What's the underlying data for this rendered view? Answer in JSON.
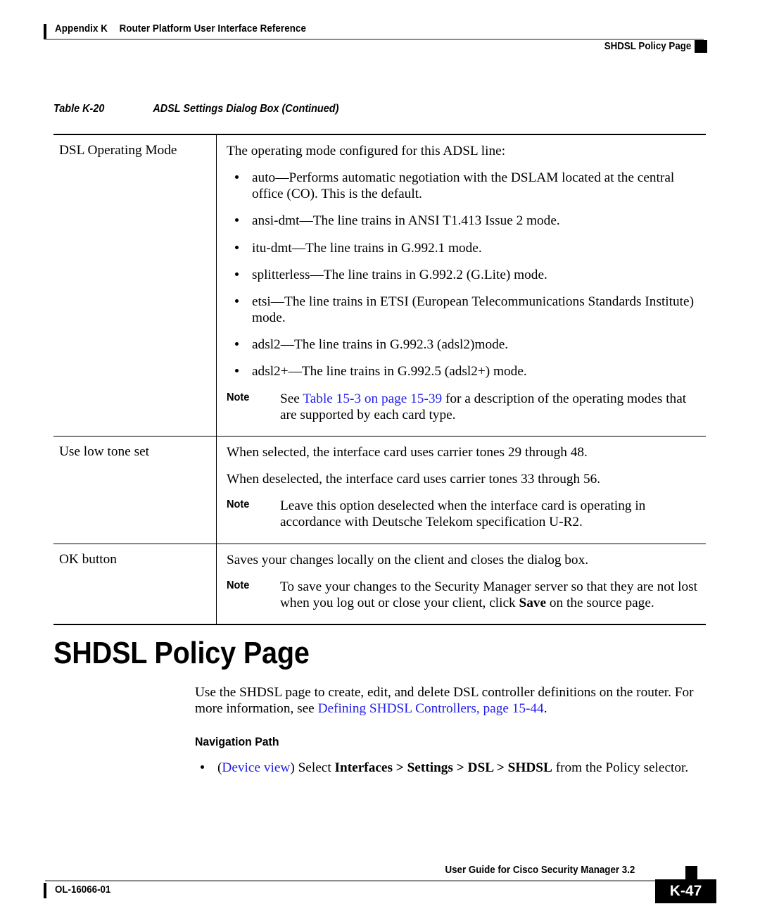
{
  "header": {
    "appendix": "Appendix K",
    "title": "Router Platform User Interface Reference",
    "section": "SHDSL Policy Page"
  },
  "table": {
    "caption_number": "Table K-20",
    "caption_title": "ADSL Settings Dialog Box (Continued)",
    "rows": [
      {
        "label": "DSL Operating Mode",
        "intro": "The operating mode configured for this ADSL line:",
        "bullets": [
          "auto—Performs automatic negotiation with the DSLAM located at the central office (CO). This is the default.",
          "ansi-dmt—The line trains in ANSI T1.413 Issue 2 mode.",
          "itu-dmt—The line trains in G.992.1 mode.",
          "splitterless—The line trains in G.992.2 (G.Lite) mode.",
          "etsi—The line trains in ETSI (European Telecommunications Standards Institute) mode.",
          "adsl2—The line trains in G.992.3 (adsl2)mode.",
          "adsl2+—The line trains in G.992.5 (adsl2+) mode."
        ],
        "note_label": "Note",
        "note_pre": "See ",
        "note_link": "Table 15-3 on page 15-39",
        "note_post": " for a description of the operating modes that are supported by each card type."
      },
      {
        "label": "Use low tone set",
        "para1": "When selected, the interface card uses carrier tones 29 through 48.",
        "para2": "When deselected, the interface card uses carrier tones 33 through 56.",
        "note_label": "Note",
        "note_text": "Leave this option deselected when the interface card is operating in accordance with Deutsche Telekom specification U-R2."
      },
      {
        "label": "OK button",
        "para1": "Saves your changes locally on the client and closes the dialog box.",
        "note_label": "Note",
        "note_pre": "To save your changes to the Security Manager server so that they are not lost when you log out or close your client, click ",
        "note_bold": "Save",
        "note_post": " on the source page."
      }
    ]
  },
  "section": {
    "heading": "SHDSL Policy Page",
    "intro_pre": "Use the SHDSL page to create, edit, and delete DSL controller definitions on the router. For more information, see ",
    "intro_link": "Defining SHDSL Controllers, page 15-44",
    "intro_post": ".",
    "nav_heading": "Navigation Path",
    "nav_link": "Device view",
    "nav_pre_paren": "(",
    "nav_post_paren": ") Select ",
    "nav_bold": "Interfaces > Settings > DSL > SHDSL",
    "nav_tail": " from the Policy selector."
  },
  "footer": {
    "doc_id": "OL-16066-01",
    "guide": "User Guide for Cisco Security Manager 3.2",
    "page_number": "K-47"
  },
  "colors": {
    "link": "#2320e8",
    "rule": "#8d8d8d",
    "text": "#000000"
  }
}
